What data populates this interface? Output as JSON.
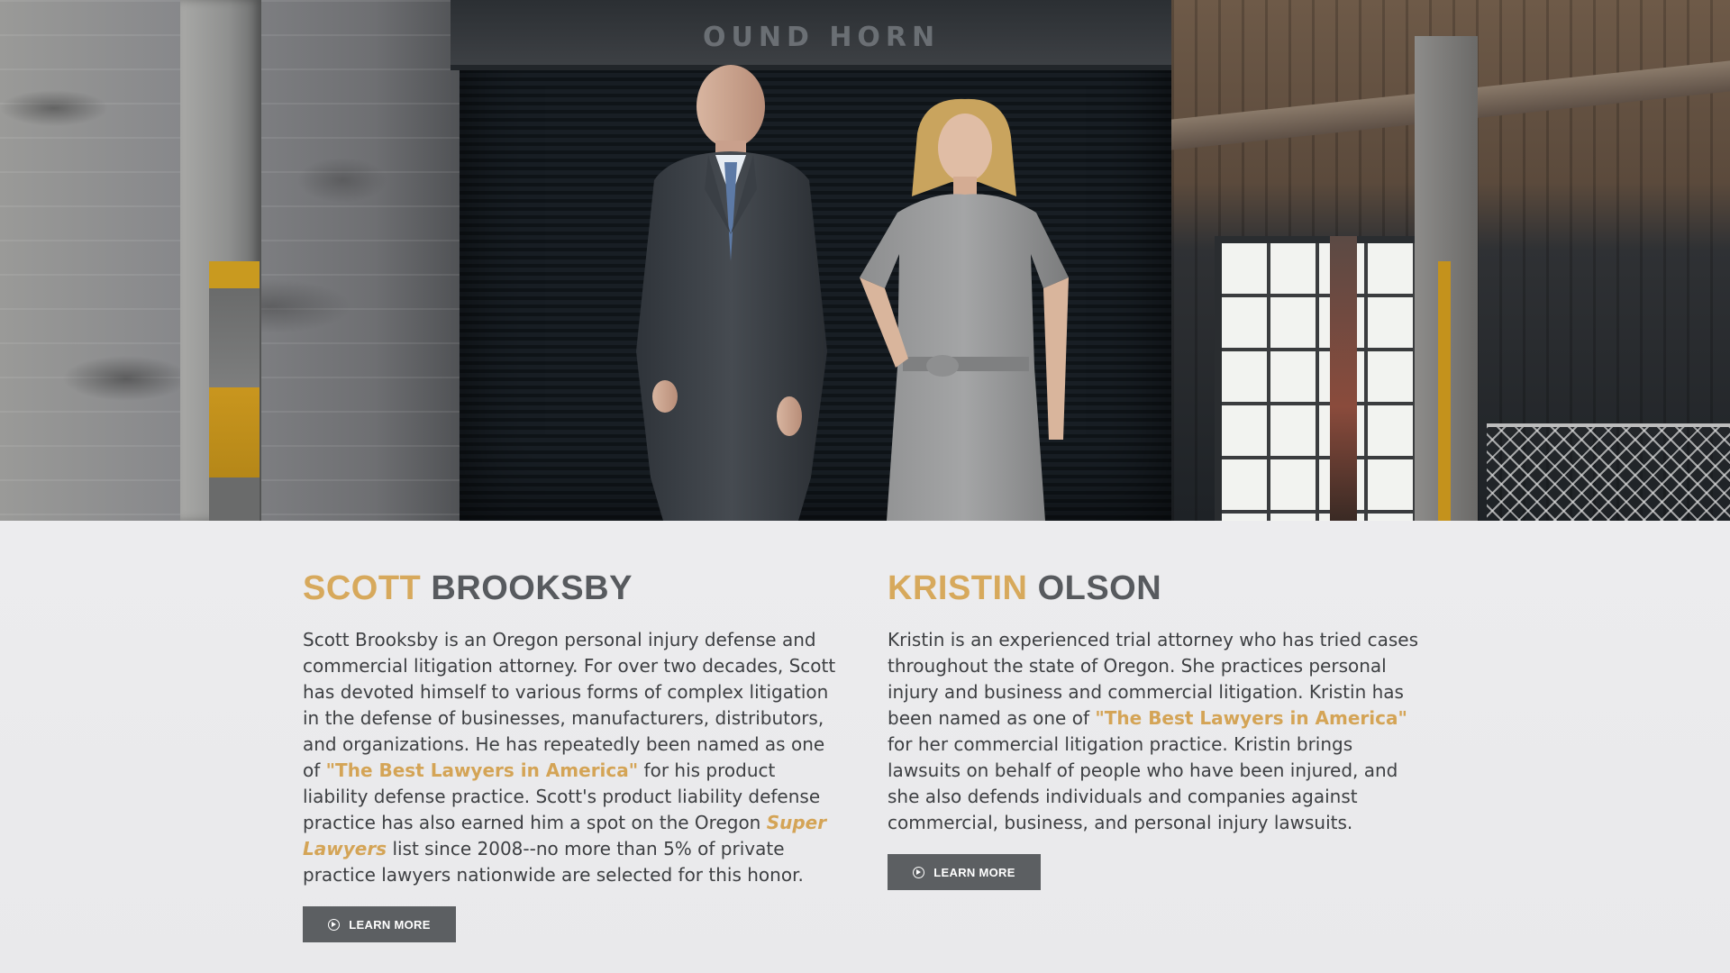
{
  "hero": {
    "garage_sign": "OUND HORN"
  },
  "attorneys": [
    {
      "first_name": "SCOTT",
      "last_name": "BROOKSBY",
      "bio": {
        "p1": "Scott Brooksby is an Oregon personal injury defense and commercial litigation attorney. For over two decades, Scott has devoted himself to various forms of complex litigation in the defense of businesses, manufacturers, distributors, and organizations.  He has repeatedly been named as one of ",
        "highlight1": "\"The Best Lawyers in America\"",
        "p2": " for his product liability defense practice.  Scott's product liability defense practice has also earned him a spot on the Oregon ",
        "highlight2": "Super Lawyers",
        "p3": " list since 2008--no more than 5% of private practice lawyers nationwide are selected for this honor."
      },
      "button_label": "LEARN MORE"
    },
    {
      "first_name": "KRISTIN",
      "last_name": "OLSON",
      "bio": {
        "p1": "Kristin is an experienced trial attorney who has tried cases throughout the state of Oregon. She practices personal injury and business and commercial litigation. Kristin has been named as one of ",
        "highlight1": "\"The Best Lawyers in America\"",
        "p2": " for her commercial litigation practice.  Kristin brings lawsuits on behalf of people who have been injured, and she also defends individuals and companies against commercial, business, and personal injury lawsuits."
      },
      "button_label": "LEARN MORE"
    }
  ],
  "colors": {
    "accent_gold": "#d7a95c",
    "name_gray": "#575a5e",
    "button_bg": "#5c5f62",
    "body_text": "#3d3f42"
  },
  "icons": {
    "button_icon": "circle-arrow-right-icon"
  }
}
